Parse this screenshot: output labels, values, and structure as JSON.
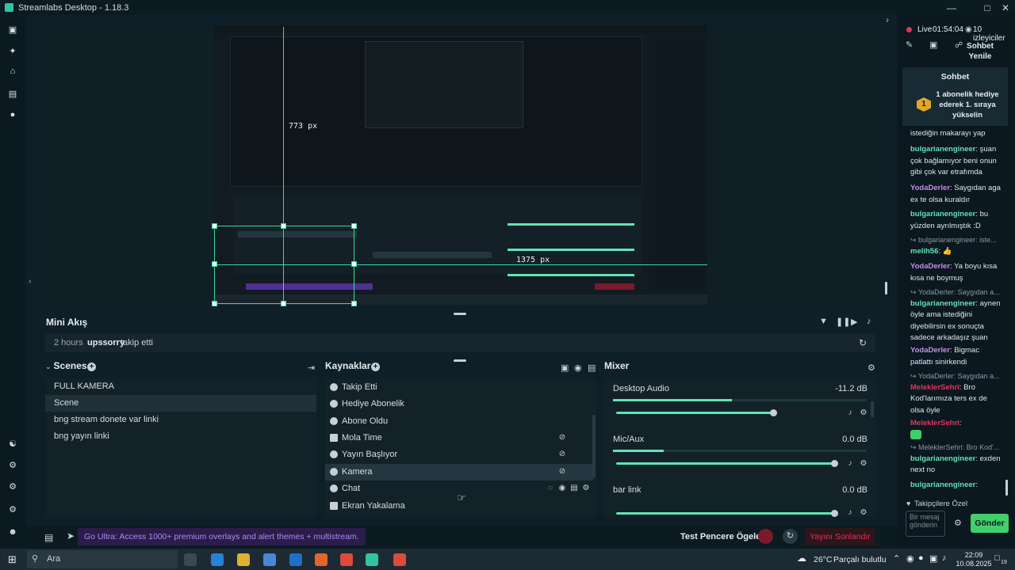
{
  "window": {
    "title": "Streamlabs Desktop - 1.18.3"
  },
  "preview": {
    "measure_vertical": "773 px",
    "measure_horizontal": "1375 px"
  },
  "mini_feed": {
    "title": "Mini Akış",
    "time": "2 hours",
    "user": "upssorry",
    "action": "takip etti"
  },
  "scenes": {
    "title": "Scenes",
    "items": [
      "FULL KAMERA",
      "Scene",
      "bng stream donete var linki",
      "bng yayın linki"
    ],
    "selected": 1
  },
  "sources": {
    "title": "Kaynaklar",
    "items": [
      "Takip Etti",
      "Hediye Abonelik",
      "Abone Oldu",
      "Mola Time",
      "Yayın Başlıyor",
      "Kamera",
      "Chat",
      "Ekran Yakalama"
    ],
    "selected": 5
  },
  "mixer": {
    "title": "Mixer",
    "channels": [
      {
        "name": "Desktop Audio",
        "db": "-11.2 dB",
        "level": 0.47,
        "volume": 0.72
      },
      {
        "name": "Mic/Aux",
        "db": "0.0 dB",
        "level": 0.2,
        "volume": 1.0
      },
      {
        "name": "bar link",
        "db": "0.0 dB",
        "level": 0.0,
        "volume": 1.0
      }
    ]
  },
  "bottom": {
    "promo": "Go Ultra: Access 1000+ premium overlays and alert themes + multistream.",
    "test_widgets": "Test Pencere Ögeleri",
    "end_stream": "Yayını Sonlandır"
  },
  "chat": {
    "live_label": "Live",
    "live_time": "01:54:04",
    "viewers": "10 izleyiciler",
    "refresh": "Sohbet Yenile",
    "header": "Sohbet",
    "pinned_rank": "1",
    "pinned": "1 abonelik hediye ederek 1. sıraya yükselin",
    "messages": [
      {
        "user": "",
        "text": "istediğin makarayı yap"
      },
      {
        "user": "bulgarianengineer",
        "text": "şuan çok bağlamıyor beni onun gibi çok var etrafımda"
      },
      {
        "user": "YodaDerler",
        "text": "Saygıdan aga ex te olsa kuraldır"
      },
      {
        "user": "bulgarianengineer",
        "text": "bu yüzden ayrılmıştık :D"
      },
      {
        "reply": "bulgarianengineer: iste...",
        "user": "melih56",
        "text": "👍"
      },
      {
        "user": "YodaDerler",
        "text": "Ya boyu kısa kısa ne boymuş"
      },
      {
        "reply": "YodaDerler: Saygıdan a...",
        "user": "bulgarianengineer",
        "text": "aynen öyle ama istediğini diyebilirsin ex sonuçta sadece arkadaşız şuan"
      },
      {
        "user": "YodaDerler",
        "text": "Bigmac patlattı sinirkendi"
      },
      {
        "reply": "YodaDerler: Saygıdan a...",
        "user": "MeleklerSehri",
        "text": "Bro Kod'larımıza ters ex de olsa öyle"
      },
      {
        "user": "MelekIerSehri",
        "text": ""
      },
      {
        "reply": "MelekIerSehri: Bro Kod'...",
        "user": "bulgarianengineer",
        "text": "exden next no"
      },
      {
        "user": "bulgarianengineer",
        "text": ""
      }
    ],
    "followers_only": "Takipçilere Özel",
    "input_placeholder": "Bir mesaj gönderin",
    "send": "Gönder"
  },
  "taskbar": {
    "search": "Ara",
    "weather_temp": "26°C",
    "weather_desc": "Parçalı bulutlu",
    "time": "22:09",
    "date": "10.08.2025",
    "notif_count": "19"
  }
}
